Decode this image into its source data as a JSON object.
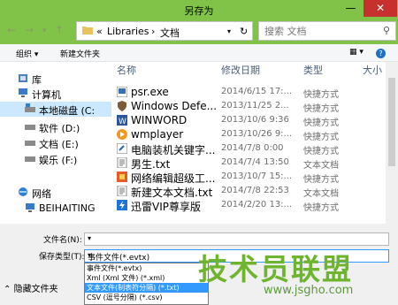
{
  "window": {
    "title": "另存为"
  },
  "title_buttons": {
    "minimize": "—",
    "close": "✕"
  },
  "address": {
    "back": "←",
    "forward": "→",
    "up": "↑",
    "chevron": "«",
    "parts": [
      "Libraries",
      "›",
      "文档"
    ]
  },
  "search": {
    "placeholder": "搜索 文档",
    "icon": "search-icon"
  },
  "toolbar": {
    "organize": "组织 ▾",
    "new_folder": "新建文件夹"
  },
  "sidebar": {
    "items": [
      {
        "label": "库",
        "icon": "library-icon"
      },
      {
        "label": "计算机",
        "icon": "computer-icon"
      },
      {
        "label": "本地磁盘 (C:",
        "icon": "drive-icon"
      },
      {
        "label": "软件 (D:)",
        "icon": "drive-icon"
      },
      {
        "label": "文档 (E:)",
        "icon": "drive-icon"
      },
      {
        "label": "娱乐 (F:)",
        "icon": "drive-icon"
      },
      {
        "label": "网络",
        "icon": "network-icon"
      },
      {
        "label": "BEIHAITING",
        "icon": "computer-icon"
      }
    ]
  },
  "columns": {
    "name": "名称",
    "modified": "修改日期",
    "type": "类型",
    "size": "大小"
  },
  "files": [
    {
      "name": "psr.exe",
      "date": "2014/6/15 17:...",
      "type": "快捷方式"
    },
    {
      "name": "Windows Defe...",
      "date": "2013/11/25 2...",
      "type": "快捷方式"
    },
    {
      "name": "WINWORD",
      "date": "2013/10/6 9:36",
      "type": "快捷方式"
    },
    {
      "name": "wmplayer",
      "date": "2013/10/26 9:...",
      "type": "快捷方式"
    },
    {
      "name": "电脑装机关键字...",
      "date": "2014/7/8 0:00",
      "type": "快捷方式"
    },
    {
      "name": "男生.txt",
      "date": "2014/7/4 13:50",
      "type": "文本文档"
    },
    {
      "name": "网络编辑超级工...",
      "date": "2013/10/7 15:...",
      "type": "快捷方式"
    },
    {
      "name": "新建文本文档.txt",
      "date": "2014/7/8 22:53",
      "type": "文本文档"
    },
    {
      "name": "迅雷VIP尊享版",
      "date": "2014/2/20 13:...",
      "type": "快捷方式"
    }
  ],
  "form": {
    "filename_label": "文件名(N):",
    "filename_value": "",
    "filetype_label": "保存类型(T):",
    "filetype_value": "事件文件(*.evtx)",
    "options": [
      "事件文件(*.evtx)",
      "Xml (Xml 文件) (*.xml)",
      "文本文件(制表符分隔) (*.txt)",
      "CSV (逗号分隔) (*.csv)"
    ],
    "selected_option_index": 2,
    "hide_folders": "隐藏文件夹"
  },
  "watermark": {
    "main": "技术员联盟",
    "sub": "www.jsgho.com"
  },
  "colors": {
    "frame": "#80c348",
    "selection": "#3399ff",
    "close": "#c7302c"
  }
}
